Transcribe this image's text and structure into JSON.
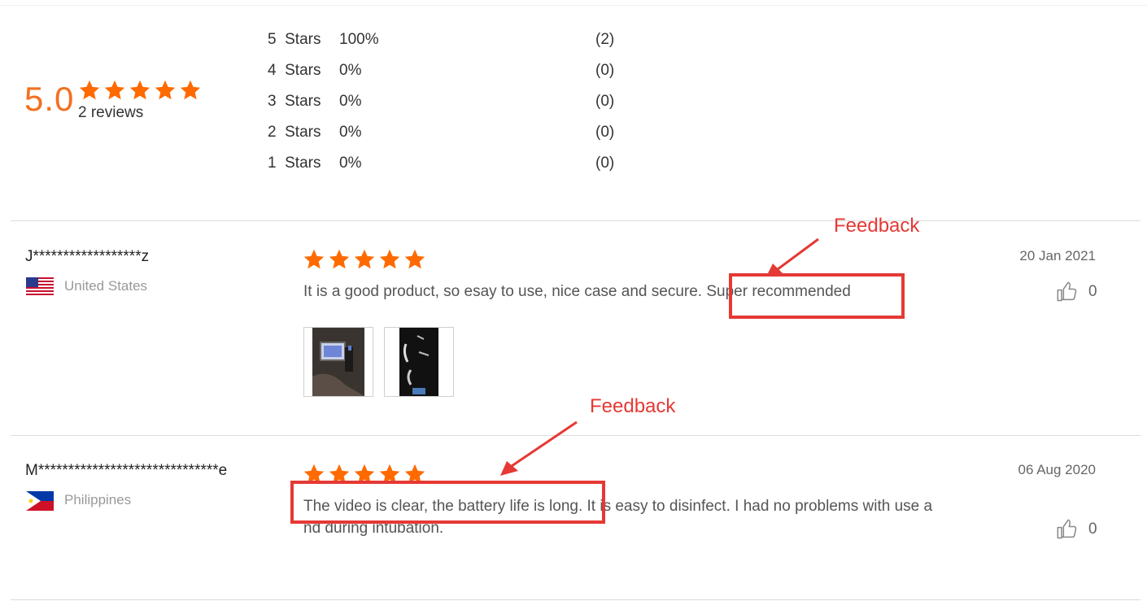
{
  "summary": {
    "average": "5.0",
    "reviews_label": "2 reviews",
    "star_color": "#ff6a00",
    "distribution": [
      {
        "label": "5  Stars",
        "percent": "100%",
        "count": "(2)"
      },
      {
        "label": "4  Stars",
        "percent": "0%",
        "count": "(0)"
      },
      {
        "label": "3  Stars",
        "percent": "0%",
        "count": "(0)"
      },
      {
        "label": "2  Stars",
        "percent": "0%",
        "count": "(0)"
      },
      {
        "label": "1  Stars",
        "percent": "0%",
        "count": "(0)"
      }
    ]
  },
  "reviews": [
    {
      "name": "J******************z",
      "country": "United States",
      "flag": "us-flag",
      "rating": 5,
      "date": "20 Jan 2021",
      "text": "It is a good product, so esay to use, nice case and secure. Super recommended",
      "likes": "0",
      "photos": [
        "device-photo-icon",
        "box-photo-icon"
      ]
    },
    {
      "name": "M******************************e",
      "country": "Philippines",
      "flag": "ph-flag",
      "rating": 5,
      "date": "06 Aug 2020",
      "text_line1": "The video is clear, the battery life is long. It is easy to disinfect. I had no problems with use a",
      "text_line2": "nd during intubation.",
      "likes": "0"
    }
  ],
  "annotations": {
    "label1": "Feedback",
    "label2": "Feedback",
    "color": "#e53935"
  }
}
